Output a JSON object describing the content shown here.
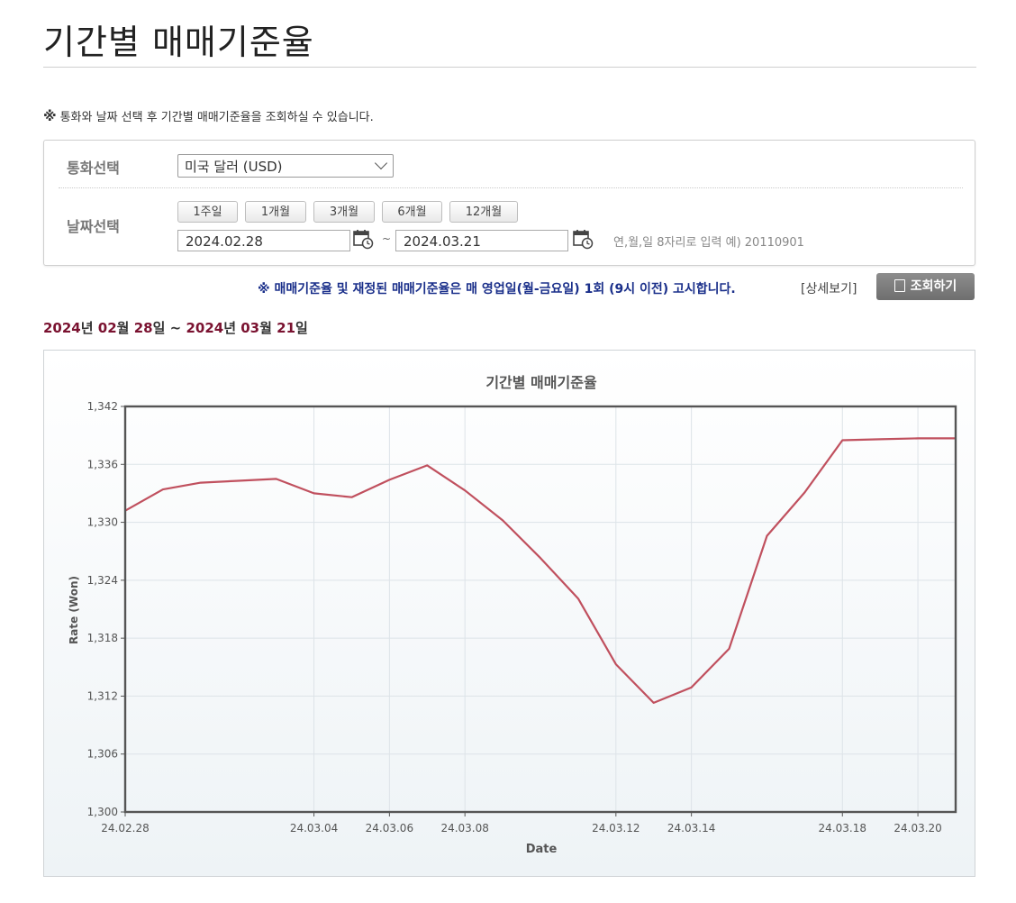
{
  "page": {
    "title": "기간별 매매기준율",
    "notice_mark": "※",
    "notice_text": "통화와 날짜 선택 후 기간별 매매기준율을 조회하실 수 있습니다."
  },
  "search": {
    "currency_label": "통화선택",
    "currency_value": "미국 달러 (USD)",
    "date_label": "날짜선택",
    "period_buttons": [
      "1주일",
      "1개월",
      "3개월",
      "6개월",
      "12개월"
    ],
    "start_date": "2024.02.28",
    "end_date": "2024.03.21",
    "date_separator": "~",
    "date_hint": "연,월,일 8자리로 입력 예) 20110901"
  },
  "announcement": {
    "text": "※ 매매기준율 및 재정된 매매기준율은 매 영업일(월-금요일) 1회 (9시 이전) 고시합니다.",
    "detail_link": "[상세보기]",
    "query_button": "조회하기"
  },
  "range": {
    "y1": "2024",
    "y_unit": "년",
    "m1": "02",
    "m_unit": "월",
    "d1": "28",
    "d_unit": "일",
    "sep": "~",
    "y2": "2024",
    "m2": "03",
    "d2": "21"
  },
  "colors": {
    "line": "#c0505e",
    "range_number": "#7a1230",
    "announce": "#1a2f8a"
  },
  "chart_data": {
    "type": "line",
    "title": "기간별 매매기준율",
    "xlabel": "Date",
    "ylabel": "Rate (Won)",
    "ylim": [
      1300,
      1342
    ],
    "xlim": [
      "2024-02-28",
      "2024-03-21"
    ],
    "grid": true,
    "yticks": [
      1300,
      1306,
      1312,
      1318,
      1324,
      1330,
      1336,
      1342
    ],
    "ytick_labels": [
      "1,300",
      "1,306",
      "1,312",
      "1,318",
      "1,324",
      "1,330",
      "1,336",
      "1,342"
    ],
    "xticks": [
      "2024-02-28",
      "2024-03-04",
      "2024-03-06",
      "2024-03-08",
      "2024-03-12",
      "2024-03-14",
      "2024-03-18",
      "2024-03-20"
    ],
    "xtick_labels": [
      "24.02.28",
      "24.03.04",
      "24.03.06",
      "24.03.08",
      "24.03.12",
      "24.03.14",
      "24.03.18",
      "24.03.20"
    ],
    "x": [
      "2024-02-28",
      "2024-02-29",
      "2024-03-01",
      "2024-03-02",
      "2024-03-03",
      "2024-03-04",
      "2024-03-05",
      "2024-03-06",
      "2024-03-07",
      "2024-03-08",
      "2024-03-09",
      "2024-03-10",
      "2024-03-11",
      "2024-03-12",
      "2024-03-13",
      "2024-03-14",
      "2024-03-15",
      "2024-03-16",
      "2024-03-17",
      "2024-03-18",
      "2024-03-19",
      "2024-03-20",
      "2024-03-21"
    ],
    "values": [
      1331.2,
      1333.4,
      1334.1,
      1334.3,
      1334.5,
      1333.0,
      1332.6,
      1334.4,
      1335.9,
      1333.3,
      1330.2,
      1326.3,
      1322.1,
      1315.3,
      1311.3,
      1312.9,
      1316.9,
      1328.6,
      1333.1,
      1338.5,
      1338.6,
      1338.7,
      1338.7
    ]
  }
}
